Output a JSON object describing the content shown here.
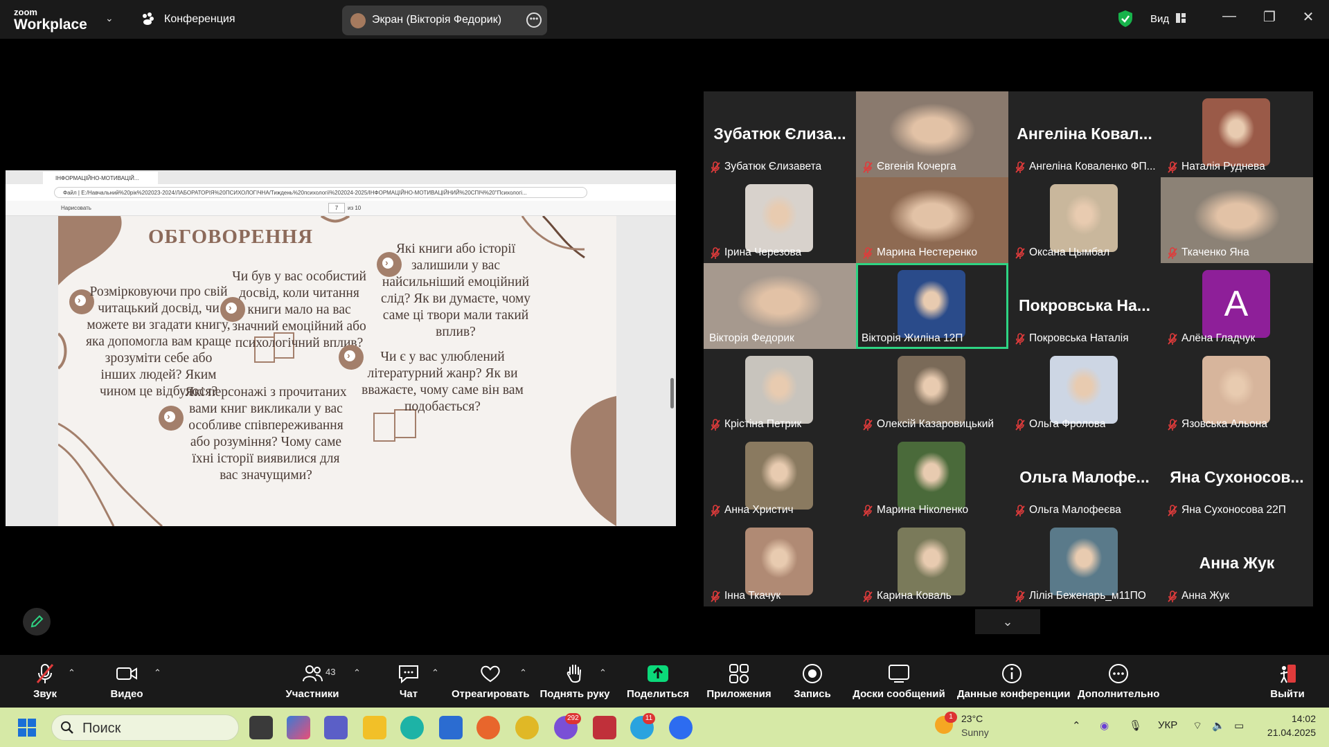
{
  "app": {
    "brand_small": "zoom",
    "brand_big": "Workplace",
    "conference_label": "Конференция",
    "view_label": "Вид"
  },
  "share": {
    "label": "Экран (Вікторія Федорик)"
  },
  "viewer": {
    "tab_title": "ІНФОРМАЦІЙНО-МОТИВАЦІЙ...",
    "url": "Файл  |  E:/Навчальний%20рік%202023-2024/ЛАБОРАТОРІЯ%20ПСИХОЛОГІЧНА/Тиждень%20психології%202024-2025/ІНФОРМАЦІЙНО-МОТИВАЦІЙНИЙ%20СПІЧ%20\"Психологі...",
    "draw_label": "Нарисовать",
    "page": "7",
    "page_of": "из 10"
  },
  "slide": {
    "title": "ОБГОВОРЕННЯ",
    "q1": "Розмірковуючи про свій читацький досвід, чи можете ви згадати книгу, яка допомогла вам краще зрозуміти себе або інших людей? Яким чином це відбулося?",
    "q2": "Чи був у вас особистий досвід, коли читання книги мало на вас значний емоційний або психологічний вплив?",
    "q3": "Які книги або історії залишили у вас найсильніший емоційний слід? Як ви думаєте, чому саме ці твори мали такий вплив?",
    "q4": "Чи є у вас улюблений літературний жанр? Як ви вважаєте, чому саме він вам подобається?",
    "q5": "Які персонажі з прочитаних вами книг викликали у вас особливе співпереживання або розуміння? Чому саме їхні історії виявилися для вас значущими?"
  },
  "participants": [
    {
      "name": "Зубатюк Єлизавета",
      "big": "Зубатюк Єлиза...",
      "kind": "name",
      "muted": true
    },
    {
      "name": "Євгенія Кочерга",
      "kind": "photo",
      "color": "#8a7a6e",
      "muted": true
    },
    {
      "name": "Ангеліна Коваленко ФП...",
      "big": "Ангеліна Ковал...",
      "kind": "name",
      "muted": true
    },
    {
      "name": "Наталія Руднева",
      "kind": "thumb",
      "color": "#9a5a48",
      "muted": true
    },
    {
      "name": "Ірина Черезова",
      "kind": "thumb",
      "color": "#d8d2cc",
      "muted": true
    },
    {
      "name": "Марина Нестеренко",
      "kind": "photo",
      "color": "#8e6a52",
      "muted": true
    },
    {
      "name": "Оксана Цымбал",
      "kind": "thumb",
      "color": "#c9b79c",
      "muted": true
    },
    {
      "name": "Ткаченко Яна",
      "kind": "photo",
      "color": "#8c8276",
      "muted": true
    },
    {
      "name": "Вікторія Федорик",
      "kind": "photo",
      "color": "#a6998e",
      "muted": false
    },
    {
      "name": "Вікторія Жиліна 12П",
      "kind": "thumb",
      "color": "#2a4b8a",
      "muted": false
    },
    {
      "name": "Покровська Наталія",
      "big": "Покровська На...",
      "kind": "name",
      "muted": true
    },
    {
      "name": "Алёна Гладчук",
      "kind": "avatar",
      "color": "#8e1f99",
      "letter": "А",
      "muted": true
    },
    {
      "name": "Крістіна Петрик",
      "kind": "thumb",
      "color": "#c8c4bd",
      "muted": true
    },
    {
      "name": "Олексій Казаровицький",
      "kind": "thumb",
      "color": "#7a6a58",
      "muted": true
    },
    {
      "name": "Ольга Фролова",
      "kind": "thumb",
      "color": "#cdd6e4",
      "muted": true
    },
    {
      "name": "Язовська Альона",
      "kind": "thumb",
      "color": "#d7b59c",
      "muted": true
    },
    {
      "name": "Анна Христич",
      "kind": "thumb",
      "color": "#8a7a60",
      "muted": true
    },
    {
      "name": "Марина Ніколенко",
      "kind": "thumb",
      "color": "#4a6a3a",
      "muted": true
    },
    {
      "name": "Ольга Малофеєва",
      "big": "Ольга Малофе...",
      "kind": "name",
      "muted": true
    },
    {
      "name": "Яна Сухоносова 22П",
      "big": "Яна Сухоносов...",
      "kind": "name",
      "muted": true
    },
    {
      "name": "Інна Ткачук",
      "kind": "thumb",
      "color": "#b08a74",
      "muted": true
    },
    {
      "name": "Карина Коваль",
      "kind": "thumb",
      "color": "#7a7a5a",
      "muted": true
    },
    {
      "name": "Лілія Беженарь_м11ПО",
      "kind": "thumb",
      "color": "#5a7a8a",
      "muted": true
    },
    {
      "name": "Анна Жук",
      "big": "Анна Жук",
      "kind": "name",
      "muted": true
    }
  ],
  "toolbar": {
    "audio": "Звук",
    "video": "Видео",
    "participants": "Участники",
    "participants_count": "43",
    "chat": "Чат",
    "react": "Отреагировать",
    "raise": "Поднять руку",
    "share": "Поделиться",
    "apps": "Приложения",
    "record": "Запись",
    "whiteboards": "Доски сообщений",
    "info": "Данные конференции",
    "more": "Дополнительно",
    "leave": "Выйти"
  },
  "taskbar": {
    "search_placeholder": "Поиск",
    "viber_badge": "292",
    "telegram_badge": "11",
    "weather_badge": "1",
    "temp": "23°C",
    "weather": "Sunny",
    "lang": "УКР",
    "time": "14:02",
    "date": "21.04.2025"
  },
  "colors": {
    "active_speaker": "#2ed483",
    "muted": "#e03b3b",
    "share_green": "#0bd97a"
  }
}
